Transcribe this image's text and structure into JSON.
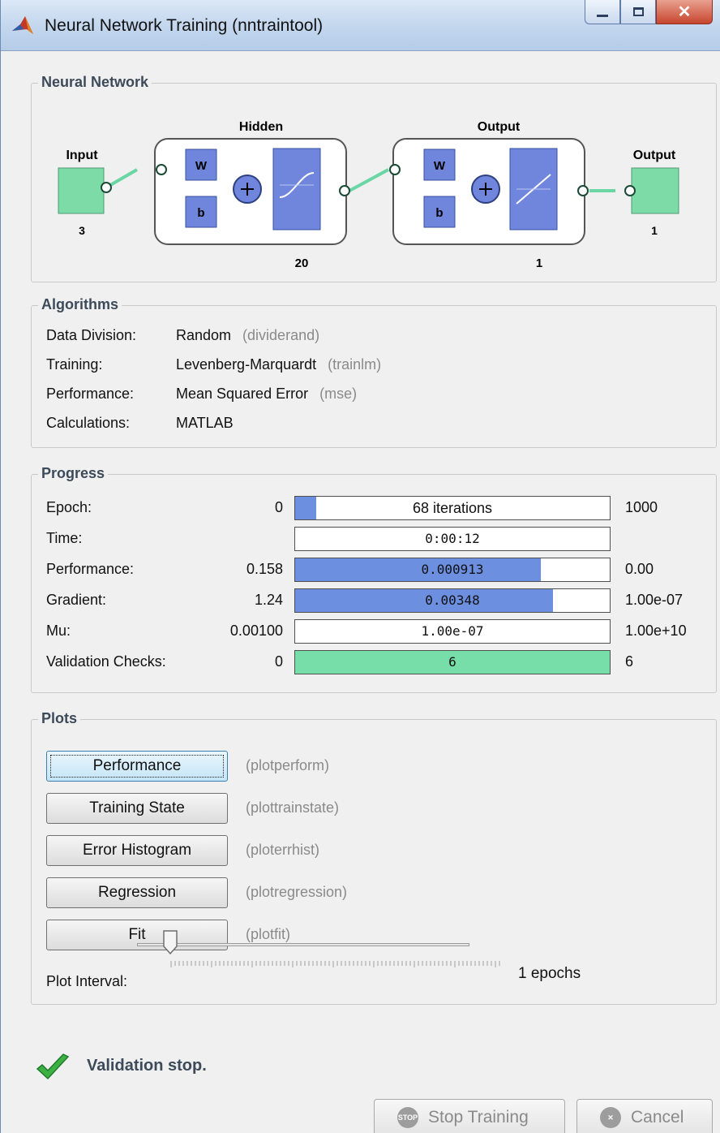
{
  "window": {
    "title": "Neural Network Training (nntraintool)"
  },
  "neural_network": {
    "group_title": "Neural Network",
    "input": {
      "label": "Input",
      "size": "3"
    },
    "hidden": {
      "label": "Hidden",
      "size": "20",
      "w": "W",
      "b": "b"
    },
    "output_layer": {
      "label": "Output",
      "size": "1",
      "w": "W",
      "b": "b"
    },
    "output": {
      "label": "Output",
      "size": "1"
    }
  },
  "algorithms": {
    "group_title": "Algorithms",
    "rows": [
      {
        "label": "Data Division:",
        "value": "Random",
        "fn": "(dividerand)"
      },
      {
        "label": "Training:",
        "value": "Levenberg-Marquardt",
        "fn": "(trainlm)"
      },
      {
        "label": "Performance:",
        "value": "Mean Squared Error",
        "fn": "(mse)"
      },
      {
        "label": "Calculations:",
        "value": "MATLAB",
        "fn": ""
      }
    ]
  },
  "progress": {
    "group_title": "Progress",
    "rows": [
      {
        "label": "Epoch:",
        "start": "0",
        "bar_text": "68 iterations",
        "end": "1000",
        "fill": 0.068,
        "color": "#6c8fe0"
      },
      {
        "label": "Time:",
        "start": "",
        "bar_text": "0:00:12",
        "end": "",
        "fill": 0,
        "color": "#6c8fe0"
      },
      {
        "label": "Performance:",
        "start": "0.158",
        "bar_text": "0.000913",
        "end": "0.00",
        "fill": 0.78,
        "color": "#6c8fe0"
      },
      {
        "label": "Gradient:",
        "start": "1.24",
        "bar_text": "0.00348",
        "end": "1.00e-07",
        "fill": 0.82,
        "color": "#6c8fe0"
      },
      {
        "label": "Mu:",
        "start": "0.00100",
        "bar_text": "1.00e-07",
        "end": "1.00e+10",
        "fill": 0,
        "color": "#6c8fe0"
      },
      {
        "label": "Validation Checks:",
        "start": "0",
        "bar_text": "6",
        "end": "6",
        "fill": 1.0,
        "color": "#77deaa"
      }
    ]
  },
  "plots": {
    "group_title": "Plots",
    "buttons": [
      {
        "label": "Performance",
        "fn": "(plotperform)"
      },
      {
        "label": "Training State",
        "fn": "(plottrainstate)"
      },
      {
        "label": "Error Histogram",
        "fn": "(ploterrhist)"
      },
      {
        "label": "Regression",
        "fn": "(plotregression)"
      },
      {
        "label": "Fit",
        "fn": "(plotfit)"
      }
    ],
    "interval_label": "Plot Interval:",
    "interval_value": "1 epochs",
    "interval_level": 0
  },
  "status": {
    "text": "Validation stop."
  },
  "actions": {
    "stop_label": "Stop Training",
    "stop_icon_text": "STOP",
    "cancel_label": "Cancel"
  },
  "colors": {
    "layer_blue": "#6f86dc",
    "io_green": "#7ddba8",
    "accent_green": "#3cb043"
  }
}
